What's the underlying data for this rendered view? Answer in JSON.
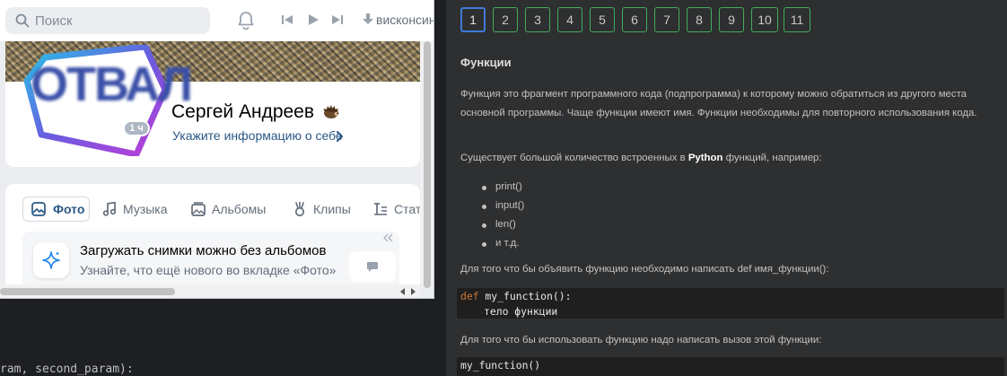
{
  "editor": {
    "code_hint": "ram, second_param):"
  },
  "vk": {
    "search": {
      "placeholder": "Поиск"
    },
    "player": {
      "track": "висконсин"
    },
    "profile": {
      "avatar_text": "ОТВАЛ",
      "online_badge": "1 ч",
      "name": "Сергей Андреев",
      "info_link": "Укажите информацию о себе"
    },
    "tabs": [
      {
        "label": "Фото",
        "icon": "image-icon",
        "active": true
      },
      {
        "label": "Музыка",
        "icon": "music-note-icon"
      },
      {
        "label": "Альбомы",
        "icon": "album-icon"
      },
      {
        "label": "Клипы",
        "icon": "clips-icon"
      },
      {
        "label": "Стат",
        "icon": "article-icon"
      }
    ],
    "promo": {
      "title": "Загружать снимки можно без альбомов",
      "text": "Узнайте, что ещё нового во вкладке «Фото»"
    }
  },
  "lesson": {
    "pages": [
      "1",
      "2",
      "3",
      "4",
      "5",
      "6",
      "7",
      "8",
      "9",
      "10",
      "11"
    ],
    "active_page": "1",
    "title": "Функции",
    "para1": "Функция это фрагмент программного кода (подпрограмма) к которому можно обратиться из другого места основной программы. Чаще функции имеют имя. Функции необходимы для повторного использования кода.",
    "para2_before": "Существует большой количество встроенных в ",
    "para2_bold": "Python",
    "para2_after": " функций, например:",
    "functions": [
      "print()",
      "input()",
      "len()",
      "и т.д."
    ],
    "para3": "Для того что бы объявить функцию необходимо написать def имя_функции():",
    "code1": {
      "keyword": "def",
      "signature": " my_function():",
      "body": "тело функции"
    },
    "para4": "Для того что бы использовать функцию надо написать вызов этой функции:",
    "code2": "my_function()"
  },
  "colors": {
    "page_border": "#3fae5b",
    "page_active_border": "#3f7bd9",
    "vk_link": "#2a5885",
    "code_keyword": "#cc7832"
  }
}
